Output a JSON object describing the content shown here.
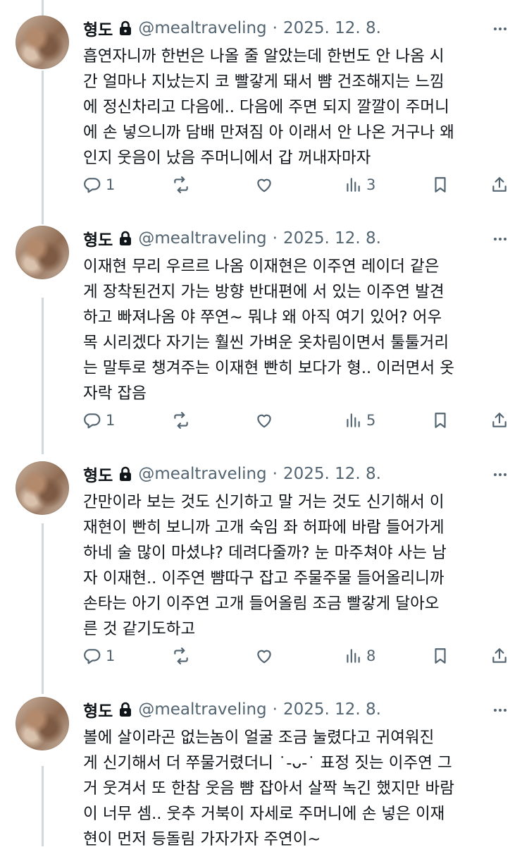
{
  "tweets": [
    {
      "name": "형도",
      "handle": "@mealtraveling",
      "dot": "·",
      "date": "2025. 12. 8.",
      "lines": [
        "흡연자니까 한번은 나올 줄 알았는데 한번도 안 나옴 시",
        "간 얼마나 지났는지 코 빨갛게 돼서 뺨 건조해지는 느낌",
        "에 정신차리고 다음에.. 다음에 주면 되지 깔깔이 주머니",
        "에 손 넣으니까 담배 만져짐 아 이래서 안 나온 거구나 왜",
        "인지 웃음이 났음 주머니에서 갑 꺼내자마자"
      ],
      "replies": "1",
      "views": "3"
    },
    {
      "name": "형도",
      "handle": "@mealtraveling",
      "dot": "·",
      "date": "2025. 12. 8.",
      "lines": [
        "이재현 무리 우르르 나옴 이재현은 이주연 레이더 같은",
        "게 장착된건지 가는 방향 반대편에 서 있는 이주연 발견",
        "하고 빠져나옴 야 쭈연~ 뭐냐 왜 아직 여기 있어? 어우",
        "목 시리겠다 자기는 훨씬 가벼운 옷차림이면서 툴툴거리",
        "는 말투로 챙겨주는 이재현 빤히 보다가 형.. 이러면서 옷",
        "자락 잡음"
      ],
      "replies": "1",
      "views": "5"
    },
    {
      "name": "형도",
      "handle": "@mealtraveling",
      "dot": "·",
      "date": "2025. 12. 8.",
      "lines": [
        "간만이라 보는 것도 신기하고 말 거는 것도 신기해서 이",
        "재현이 빤히 보니까 고개 숙임 좌 허파에 바람 들어가게",
        "하네 술 많이 마셨냐? 데려다줄까? 눈 마주쳐야 사는 남",
        "자 이재현.. 이주연 뺨따구 잡고 주물주물 들어올리니까",
        "손타는 아기 이주연 고개 들어올림 조금 빨갛게 달아오",
        "른 것 같기도하고"
      ],
      "replies": "1",
      "views": "8"
    },
    {
      "name": "형도",
      "handle": "@mealtraveling",
      "dot": "·",
      "date": "2025. 12. 8.",
      "lines": [
        "볼에 살이라곤 없는놈이 얼굴 조금 눌렸다고 귀여워진",
        "게 신기해서 더 쭈물거렸더니 ˙-ᴗ-˙ 표정 짓는 이주연 그",
        "거 웃겨서 또 한참 웃음 뺨 잡아서 살짝 녹긴 했지만 바람",
        "이 너무 셈.. 웃추 거북이 자세로 주머니에 손 넣은 이재",
        "현이 먼저 등돌림 가자가자 주연이~"
      ]
    }
  ]
}
